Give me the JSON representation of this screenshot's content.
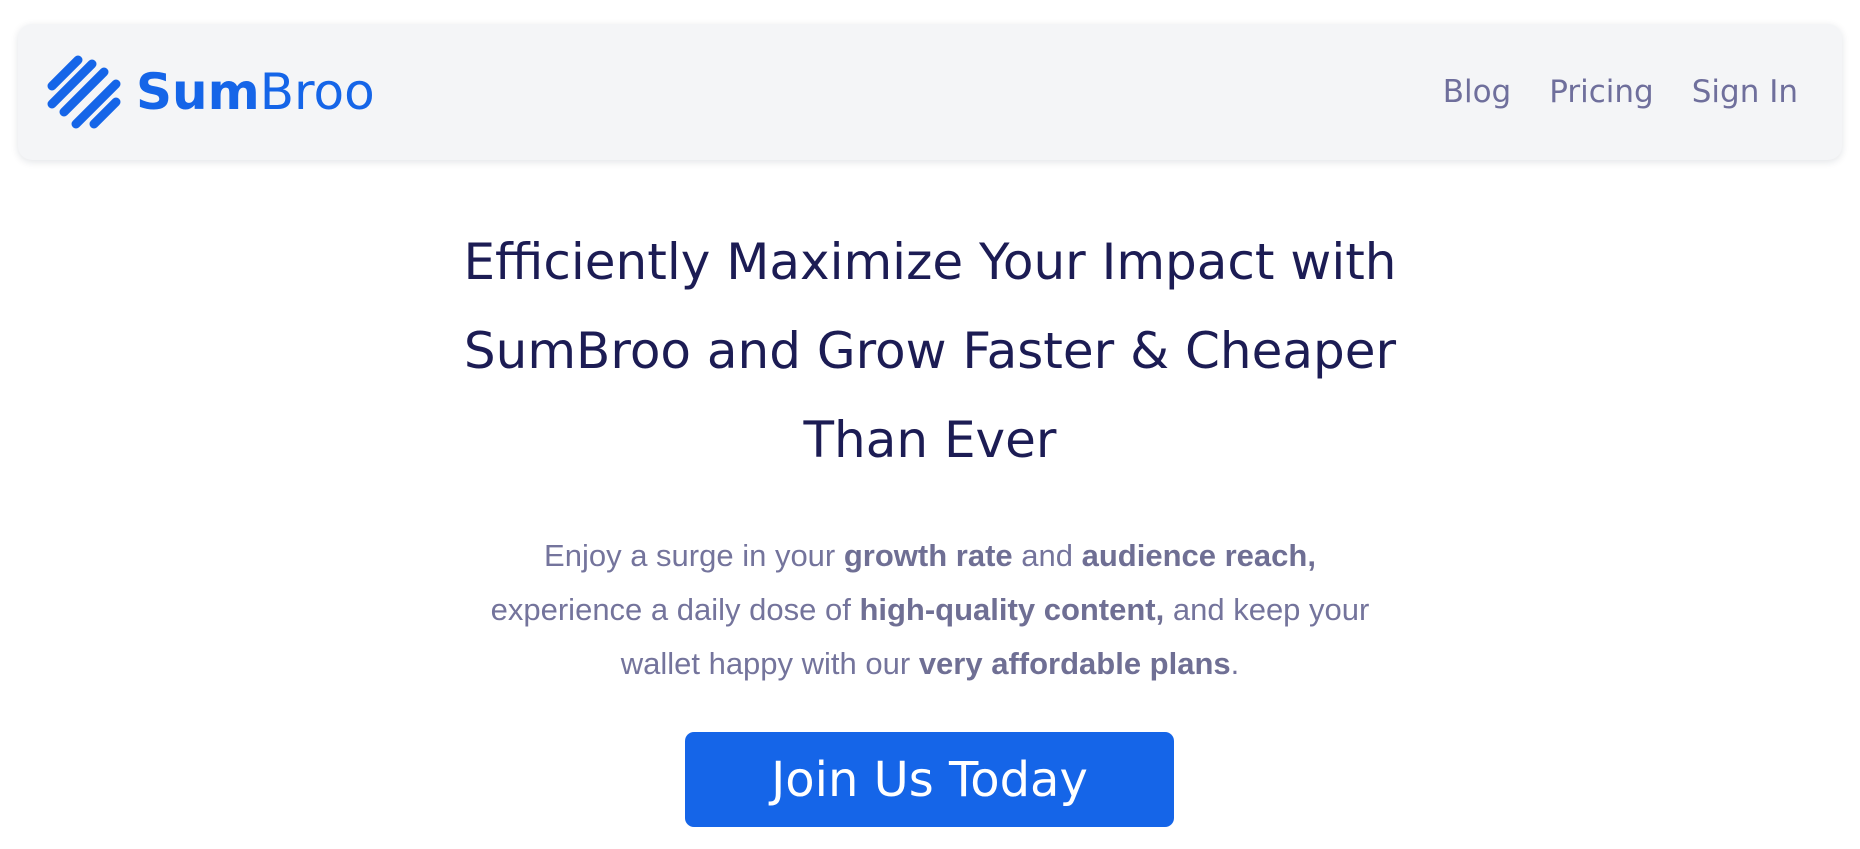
{
  "brand": {
    "name_bold": "Sum",
    "name_regular": "Broo",
    "icon": "diagonal-stripes-logo-icon",
    "color": "#1565e8"
  },
  "nav": {
    "links": [
      {
        "label": "Blog"
      },
      {
        "label": "Pricing"
      },
      {
        "label": "Sign In"
      }
    ],
    "link_color": "#6f6f9c"
  },
  "hero": {
    "title_lines": [
      "Efficiently Maximize Your Impact with",
      "SumBroo and Grow Faster & Cheaper",
      "Than Ever"
    ],
    "subtitle": {
      "p1": "Enjoy a surge in your ",
      "b1": "growth rate",
      "p2": " and ",
      "b2": "audience reach,",
      "p3": " experience a daily dose of ",
      "b3": "high-quality content,",
      "p4": " and keep your wallet happy with our ",
      "b4": "very affordable plans",
      "p5": "."
    },
    "title_color": "#1c1c54",
    "subtitle_color": "#74749c"
  },
  "cta": {
    "label": "Join Us Today",
    "color": "#1565e8"
  }
}
